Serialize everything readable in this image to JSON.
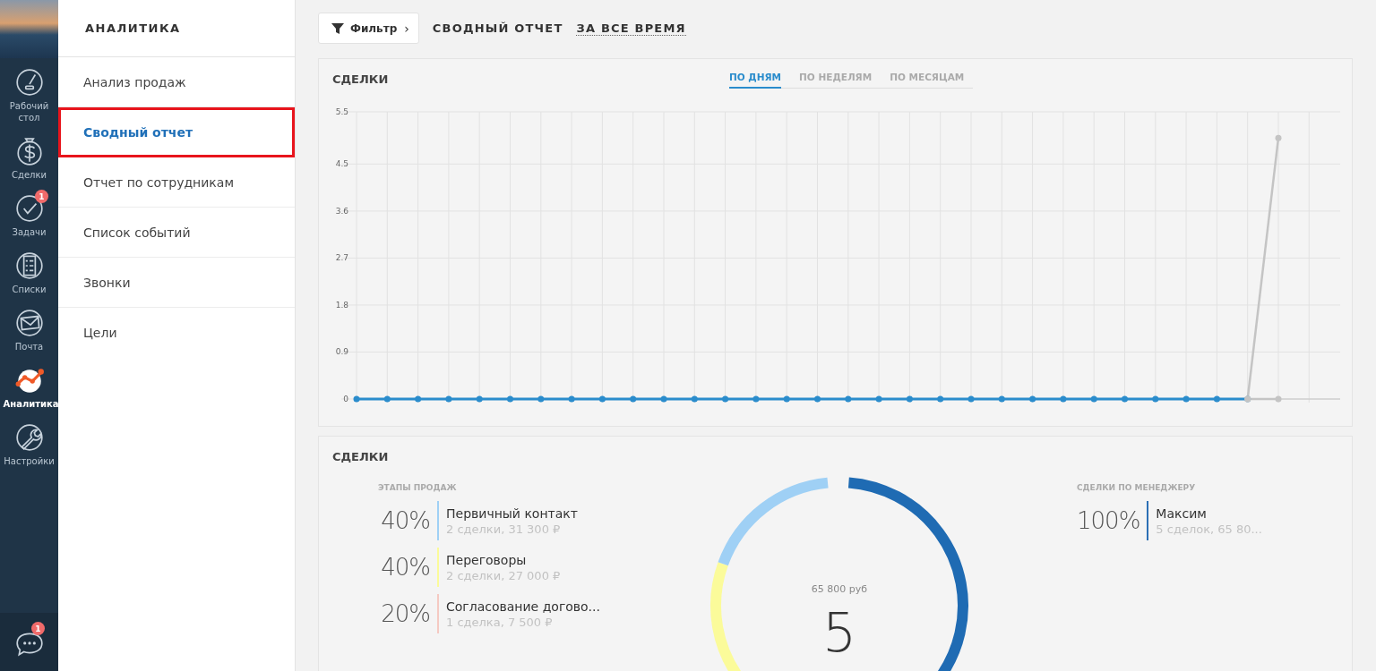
{
  "rail": {
    "items": [
      {
        "label": "Рабочий стол",
        "selected": false
      },
      {
        "label": "Сделки",
        "selected": false
      },
      {
        "label": "Задачи",
        "selected": false,
        "badge": "1"
      },
      {
        "label": "Списки",
        "selected": false
      },
      {
        "label": "Почта",
        "selected": false
      },
      {
        "label": "Аналитика",
        "selected": true
      },
      {
        "label": "Настройки",
        "selected": false
      }
    ],
    "chat_badge": "1"
  },
  "sidebar": {
    "title": "АНАЛИТИКА",
    "items": [
      {
        "label": "Анализ продаж",
        "selected": false
      },
      {
        "label": "Сводный отчет",
        "selected": true
      },
      {
        "label": "Отчет по сотрудникам",
        "selected": false
      },
      {
        "label": "Список событий",
        "selected": false
      },
      {
        "label": "Звонки",
        "selected": false
      },
      {
        "label": "Цели",
        "selected": false
      }
    ]
  },
  "toolbar": {
    "filter": "Фильтр",
    "arrow": "›",
    "title": "СВОДНЫЙ ОТЧЕТ",
    "period": "ЗА ВСЕ ВРЕМЯ"
  },
  "chart_card": {
    "title": "СДЕЛКИ",
    "tabs": [
      {
        "label": "ПО ДНЯМ",
        "selected": true
      },
      {
        "label": "ПО НЕДЕЛЯМ",
        "selected": false
      },
      {
        "label": "ПО МЕСЯЦАМ",
        "selected": false
      }
    ],
    "chart_data": {
      "type": "line",
      "ylim": [
        0,
        5.5
      ],
      "grid": true,
      "yticks": [
        0,
        0.9,
        1.8,
        2.7,
        3.6,
        4.5,
        5.5
      ],
      "series": [
        {
          "color": "#2a8ccc",
          "marker": "circle",
          "values": [
            0,
            0,
            0,
            0,
            0,
            0,
            0,
            0,
            0,
            0,
            0,
            0,
            0,
            0,
            0,
            0,
            0,
            0,
            0,
            0,
            0,
            0,
            0,
            0,
            0,
            0,
            0,
            0,
            0,
            0,
            null
          ]
        },
        {
          "color": "#c4c4c4",
          "marker": "circle",
          "values": [
            null,
            null,
            null,
            null,
            null,
            null,
            null,
            null,
            null,
            null,
            null,
            null,
            null,
            null,
            null,
            null,
            null,
            null,
            null,
            null,
            null,
            null,
            null,
            null,
            null,
            null,
            null,
            null,
            null,
            0,
            5
          ]
        },
        {
          "color": "#c4c4c4",
          "marker": "circle",
          "values": [
            null,
            null,
            null,
            null,
            null,
            null,
            null,
            null,
            null,
            null,
            null,
            null,
            null,
            null,
            null,
            null,
            null,
            null,
            null,
            null,
            null,
            null,
            null,
            null,
            null,
            null,
            null,
            null,
            null,
            0,
            0
          ]
        }
      ]
    }
  },
  "deals_card": {
    "title": "СДЕЛКИ",
    "stages": {
      "title": "ЭТАПЫ ПРОДАЖ",
      "items": [
        {
          "percent": "40%",
          "name": "Первичный контакт",
          "detail": "2 сделки, 31 300 ₽",
          "color": "#9fd0f5"
        },
        {
          "percent": "40%",
          "name": "Переговоры",
          "detail": "2 сделки, 27 000 ₽",
          "color": "#fbfb9a"
        },
        {
          "percent": "20%",
          "name": "Согласование догово...",
          "detail": "1 сделка, 7 500 ₽",
          "color": "#f5c9c2"
        }
      ]
    },
    "donut": {
      "amount": "65 800 руб",
      "count": "5"
    },
    "managers": {
      "title": "СДЕЛКИ ПО МЕНЕДЖЕРУ",
      "items": [
        {
          "percent": "100%",
          "name": "Максим",
          "detail": "5 сделок, 65 80...",
          "color": "#2c6fb5"
        }
      ]
    }
  }
}
